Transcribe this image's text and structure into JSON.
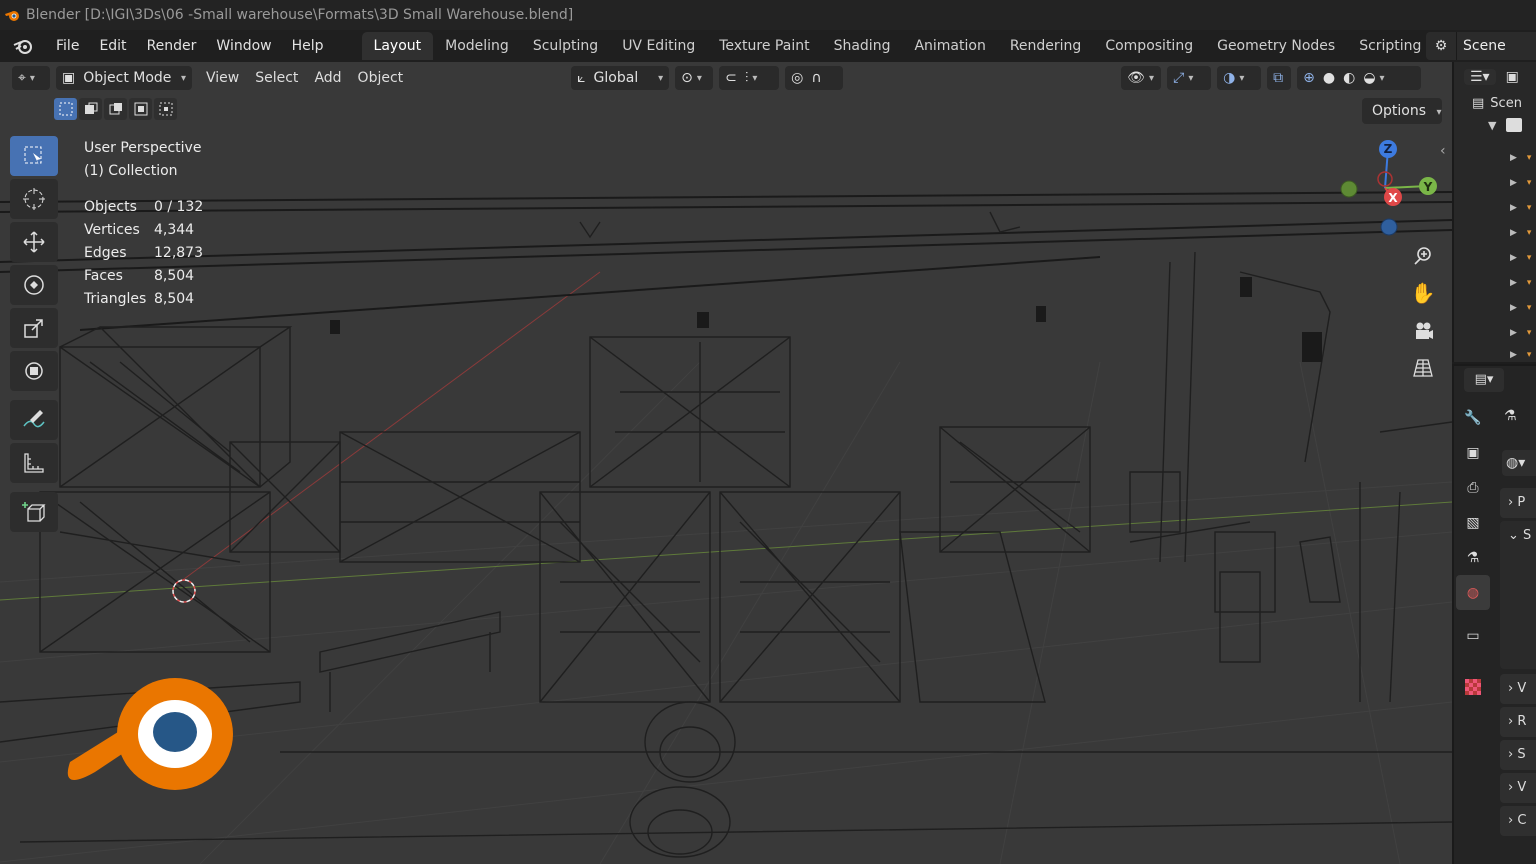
{
  "window": {
    "title": "Blender [D:\\IGI\\3Ds\\06 -Small warehouse\\Formats\\3D Small Warehouse.blend]"
  },
  "menu": {
    "items": [
      "File",
      "Edit",
      "Render",
      "Window",
      "Help"
    ]
  },
  "workspaces": {
    "tabs": [
      "Layout",
      "Modeling",
      "Sculpting",
      "UV Editing",
      "Texture Paint",
      "Shading",
      "Animation",
      "Rendering",
      "Compositing",
      "Geometry Nodes",
      "Scripting"
    ],
    "active": "Layout"
  },
  "scene_selector": {
    "label": "Scene"
  },
  "viewport_header": {
    "mode": "Object Mode",
    "menus": [
      "View",
      "Select",
      "Add",
      "Object"
    ],
    "orientation": "Global",
    "options_label": "Options"
  },
  "overlay": {
    "perspective": "User Perspective",
    "collection": "(1) Collection",
    "stats": [
      {
        "label": "Objects",
        "value": "0 / 132"
      },
      {
        "label": "Vertices",
        "value": "4,344"
      },
      {
        "label": "Edges",
        "value": "12,873"
      },
      {
        "label": "Faces",
        "value": "8,504"
      },
      {
        "label": "Triangles",
        "value": "8,504"
      }
    ]
  },
  "gizmo": {
    "x": "X",
    "y": "Y",
    "z": "Z"
  },
  "outliner": {
    "header": "Scen"
  },
  "properties": {
    "panels": [
      "P",
      "S",
      "V",
      "R",
      "S",
      "V",
      "C"
    ]
  },
  "colors": {
    "accent": "#4772b3",
    "blender_orange": "#ea7600",
    "blender_blue": "#265787"
  }
}
